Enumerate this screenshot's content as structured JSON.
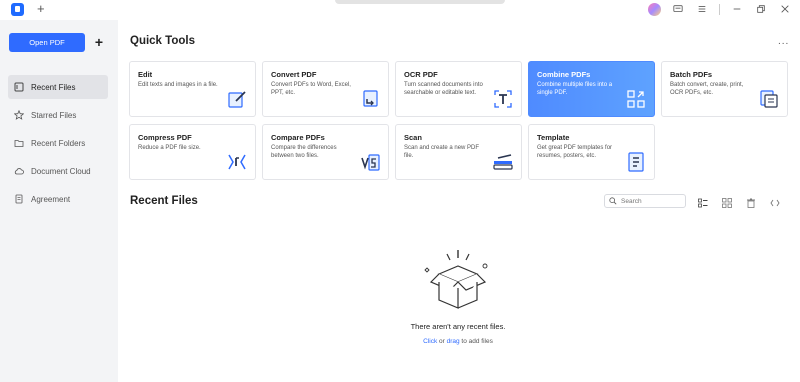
{
  "titlebar": {
    "new_tab": "+",
    "icons": [
      "avatar",
      "message-icon",
      "menu-icon",
      "minimize-icon",
      "restore-icon",
      "close-icon"
    ]
  },
  "sidebar": {
    "open_pdf": "Open PDF",
    "add": "+",
    "items": [
      {
        "label": "Recent Files",
        "icon": "recent-icon",
        "active": true
      },
      {
        "label": "Starred Files",
        "icon": "star-icon",
        "active": false
      },
      {
        "label": "Recent Folders",
        "icon": "folder-icon",
        "active": false
      },
      {
        "label": "Document Cloud",
        "icon": "cloud-icon",
        "active": false
      },
      {
        "label": "Agreement",
        "icon": "agreement-icon",
        "active": false
      }
    ]
  },
  "quick_tools": {
    "title": "Quick Tools",
    "more": "...",
    "cards": [
      {
        "title": "Edit",
        "desc": "Edit texts and images in a file."
      },
      {
        "title": "Convert PDF",
        "desc": "Convert PDFs to Word, Excel, PPT, etc."
      },
      {
        "title": "OCR PDF",
        "desc": "Turn scanned documents into searchable or editable text."
      },
      {
        "title": "Combine PDFs",
        "desc": "Combine multiple files into a single PDF."
      },
      {
        "title": "Batch PDFs",
        "desc": "Batch convert, create, print, OCR PDFs, etc."
      },
      {
        "title": "Compress PDF",
        "desc": "Reduce a PDF file size."
      },
      {
        "title": "Compare PDFs",
        "desc": "Compare the differences between two files."
      },
      {
        "title": "Scan",
        "desc": "Scan and create a new PDF file."
      },
      {
        "title": "Template",
        "desc": "Get great PDF templates for resumes, posters, etc."
      }
    ]
  },
  "recent": {
    "title": "Recent Files",
    "search_placeholder": "Search",
    "empty_title": "There aren't any recent files.",
    "click": "Click",
    "or": " or ",
    "drag": "drag",
    "to_add": " to add files"
  },
  "colors": {
    "accent": "#2f6bff",
    "highlight_card": "#4f8bff",
    "sidebar_bg": "#f3f4f6"
  }
}
